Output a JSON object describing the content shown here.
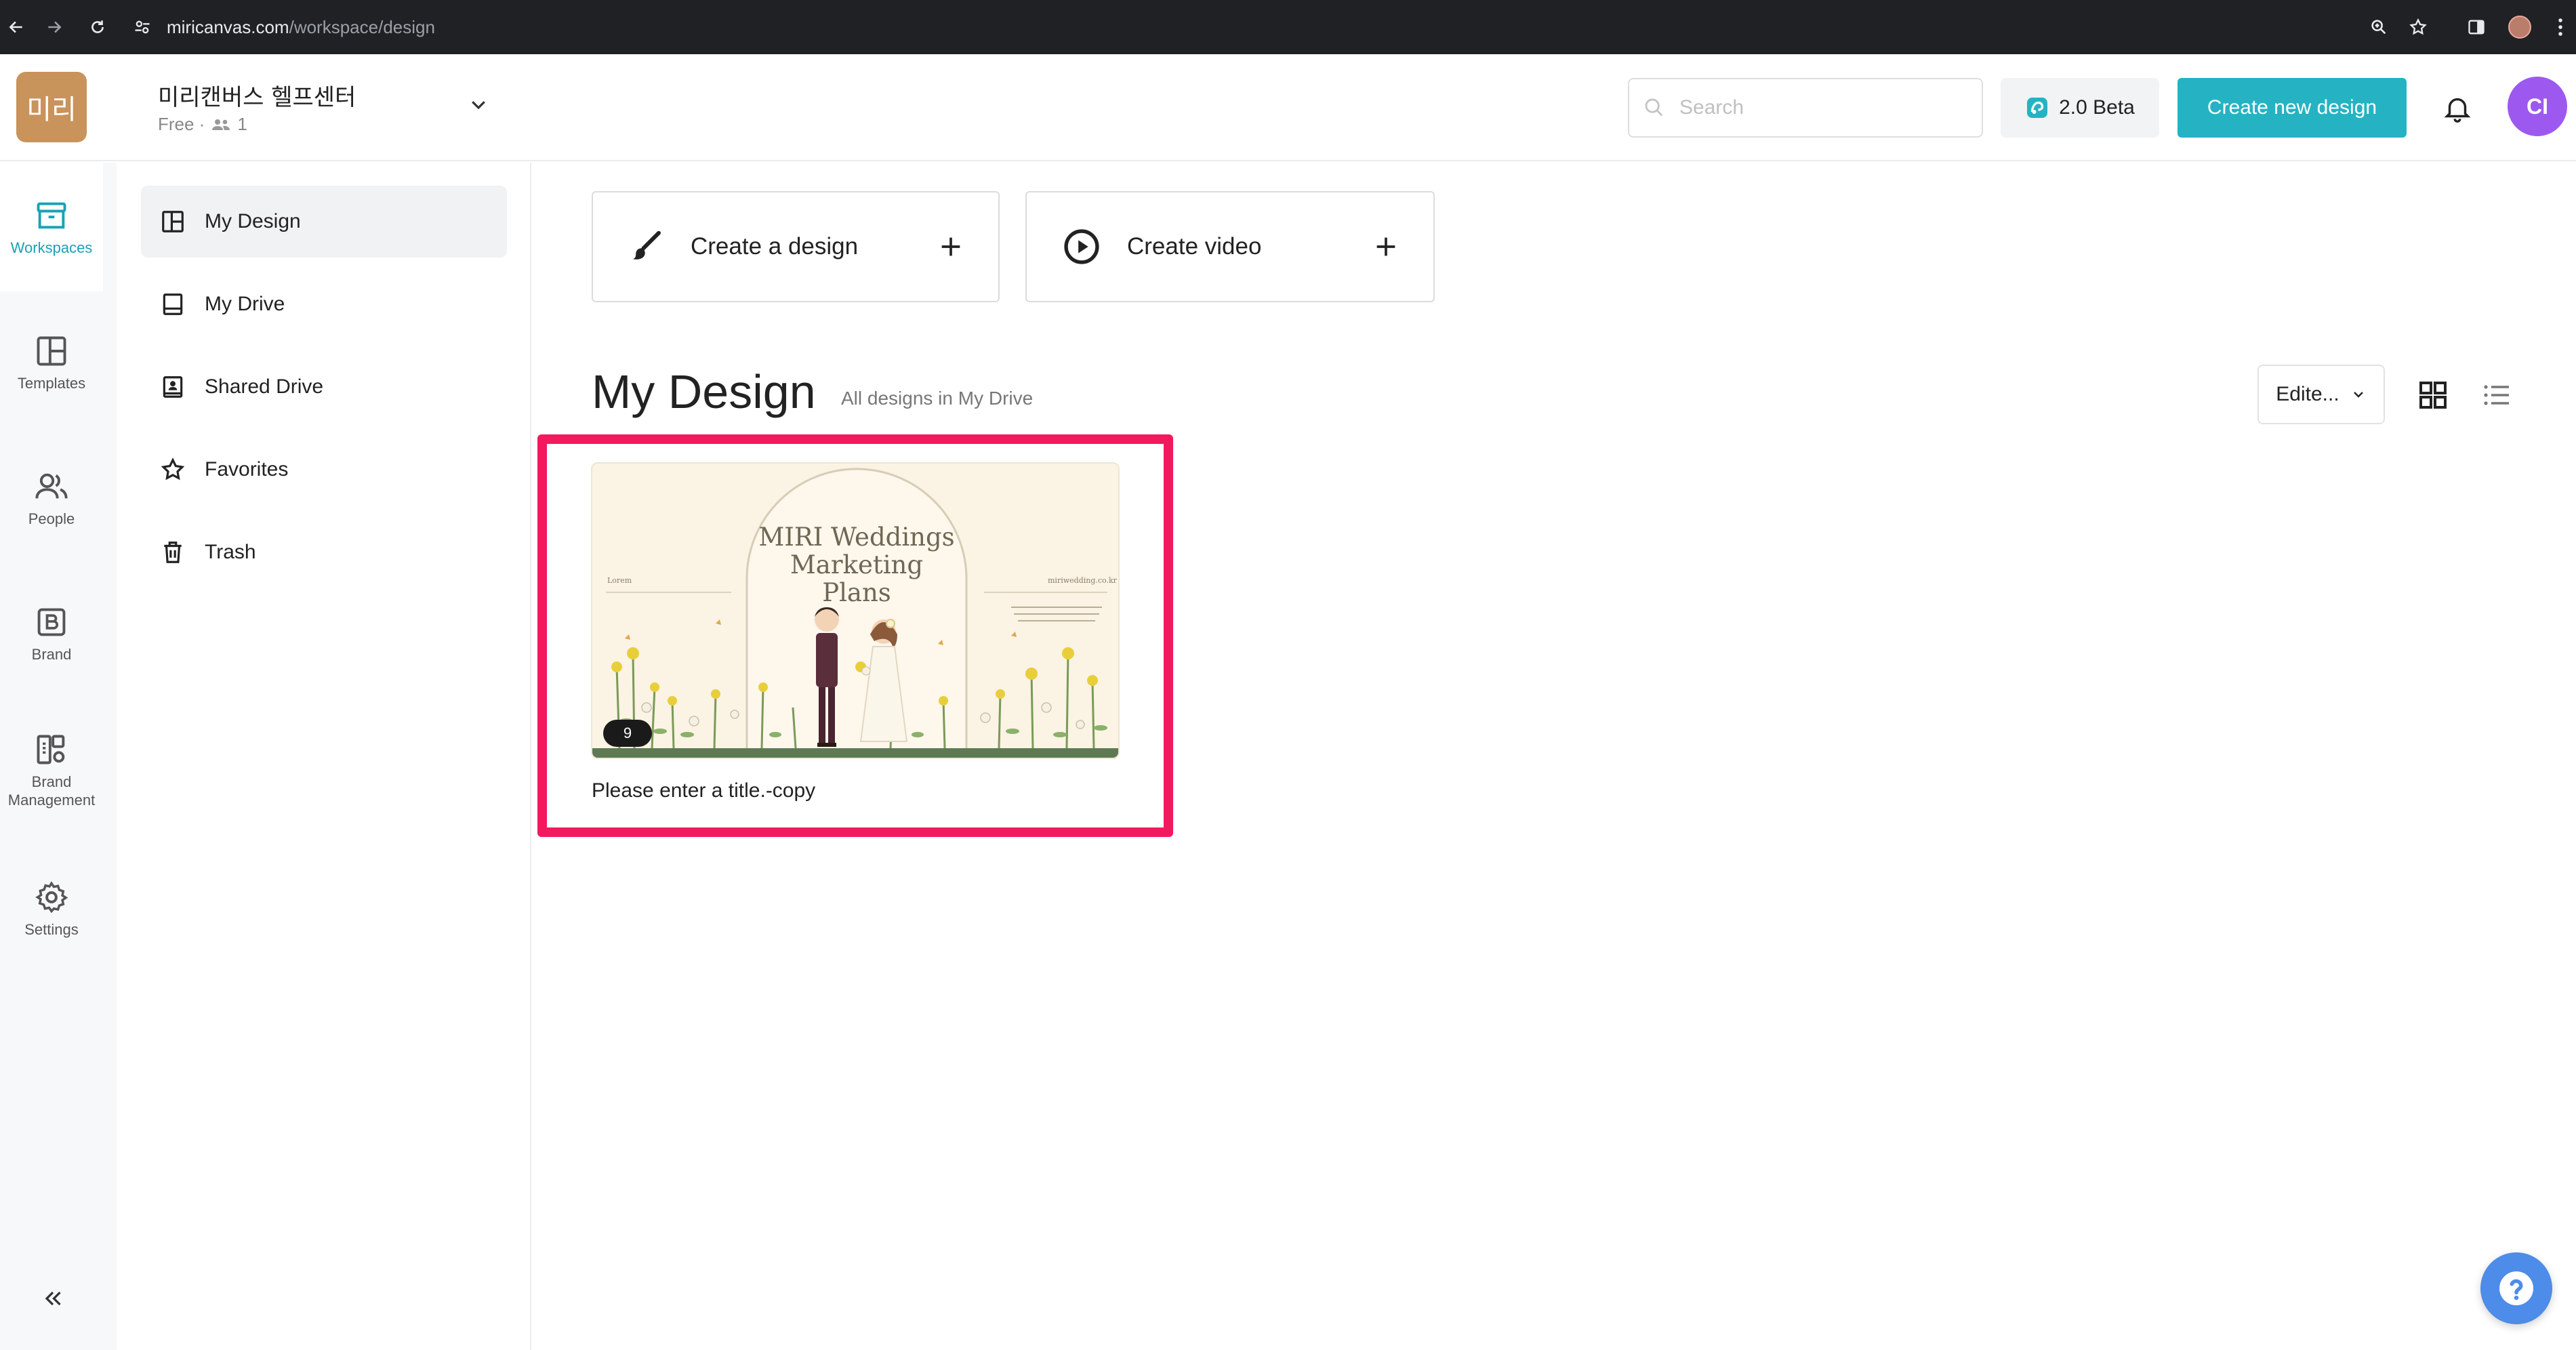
{
  "browser": {
    "url_host": "miricanvas.com",
    "url_path": "/workspace/design"
  },
  "header": {
    "logo_text": "미리",
    "workspace_name": "미리캔버스 헬프센터",
    "plan": "Free ·",
    "member_count": "1",
    "search_placeholder": "Search",
    "beta_label": "2.0 Beta",
    "create_label": "Create new design",
    "avatar_initials": "CI"
  },
  "rail": {
    "items": [
      {
        "label": "Workspaces",
        "icon": "workspace-icon"
      },
      {
        "label": "Templates",
        "icon": "templates-icon"
      },
      {
        "label": "People",
        "icon": "people-icon"
      },
      {
        "label": "Brand",
        "icon": "brand-icon"
      },
      {
        "label": "Brand Management",
        "icon": "brand-management-icon"
      },
      {
        "label": "Settings",
        "icon": "settings-icon"
      }
    ],
    "collapse_icon": "double-chevron-left-icon"
  },
  "subnav": {
    "items": [
      {
        "label": "My Design",
        "icon": "grid-layout-icon"
      },
      {
        "label": "My Drive",
        "icon": "drive-icon"
      },
      {
        "label": "Shared Drive",
        "icon": "shared-drive-icon"
      },
      {
        "label": "Favorites",
        "icon": "star-icon"
      },
      {
        "label": "Trash",
        "icon": "trash-icon"
      }
    ]
  },
  "main": {
    "create_design_label": "Create a design",
    "create_video_label": "Create video",
    "title": "My Design",
    "subtitle": "All designs in My Drive",
    "sort_label": "Edite...",
    "designs": [
      {
        "title": "Please enter a title.-copy",
        "page_count": "9",
        "thumbnail_title": "MIRI Weddings\nMarketing\nPlans",
        "thumbnail_left_text": "Lorem",
        "thumbnail_right_text": "miriwedding.co.kr"
      }
    ]
  },
  "colors": {
    "accent": "#25b3c3",
    "highlight": "#f2195f",
    "avatar": "#9d59ef",
    "help": "#4d8ce8"
  }
}
